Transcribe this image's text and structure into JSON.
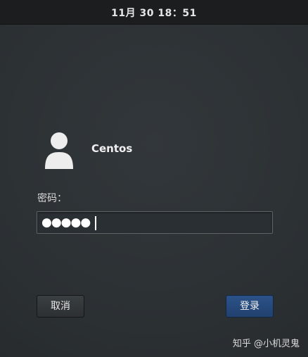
{
  "topbar": {
    "clock": "11月 30  18：51"
  },
  "user": {
    "name": "Centos",
    "avatar_icon": "user-silhouette-icon"
  },
  "password": {
    "label": "密码：",
    "masked_value": "●●●●●"
  },
  "buttons": {
    "cancel_label": "取消",
    "login_label": "登录"
  },
  "watermark": {
    "text": "知乎 @小机灵鬼"
  },
  "colors": {
    "accent": "#23467a",
    "background": "#2d3236",
    "topbar": "#1b1d1f"
  }
}
